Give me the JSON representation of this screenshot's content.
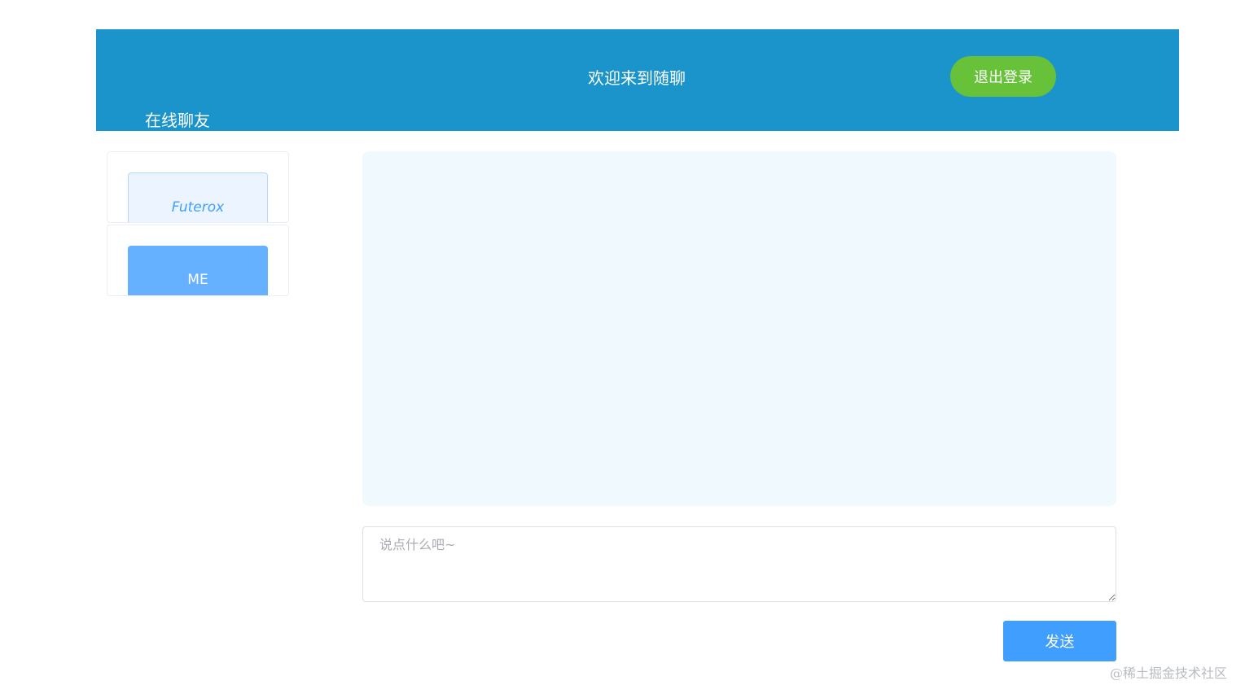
{
  "header": {
    "title": "欢迎来到随聊",
    "logout_label": "退出登录",
    "online_label": "在线聊友"
  },
  "friends": [
    {
      "name": "Futerox"
    },
    {
      "name": "ME"
    }
  ],
  "composer": {
    "placeholder": "说点什么吧~",
    "value": "",
    "send_label": "发送"
  },
  "watermark": "@稀土掘金技术社区",
  "colors": {
    "header_bg": "#1a94cb",
    "logout_bg": "#67c23a",
    "send_bg": "#409eff",
    "me_chip_bg": "#66b1ff",
    "other_chip_bg": "#ecf5ff",
    "message_area_bg": "#f0fafe"
  }
}
